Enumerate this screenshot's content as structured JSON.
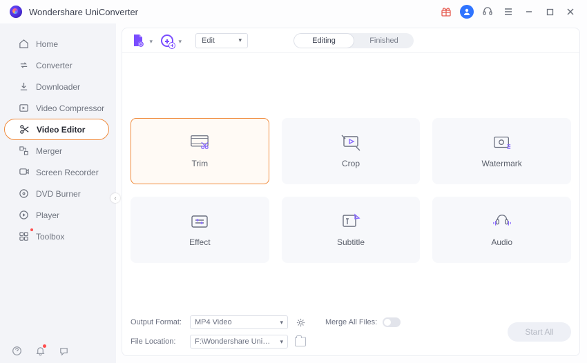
{
  "app": {
    "title": "Wondershare UniConverter"
  },
  "sidebar": {
    "items": [
      {
        "label": "Home"
      },
      {
        "label": "Converter"
      },
      {
        "label": "Downloader"
      },
      {
        "label": "Video Compressor"
      },
      {
        "label": "Video Editor"
      },
      {
        "label": "Merger"
      },
      {
        "label": "Screen Recorder"
      },
      {
        "label": "DVD Burner"
      },
      {
        "label": "Player"
      },
      {
        "label": "Toolbox"
      }
    ]
  },
  "toolbar": {
    "edit_dropdown": "Edit",
    "segment": {
      "editing": "Editing",
      "finished": "Finished"
    }
  },
  "cards": {
    "trim": "Trim",
    "crop": "Crop",
    "watermark": "Watermark",
    "effect": "Effect",
    "subtitle": "Subtitle",
    "audio": "Audio"
  },
  "bottom": {
    "output_format_label": "Output Format:",
    "output_format_value": "MP4 Video",
    "file_location_label": "File Location:",
    "file_location_value": "F:\\Wondershare UniConverter",
    "merge_label": "Merge All Files:",
    "start_all": "Start All"
  }
}
